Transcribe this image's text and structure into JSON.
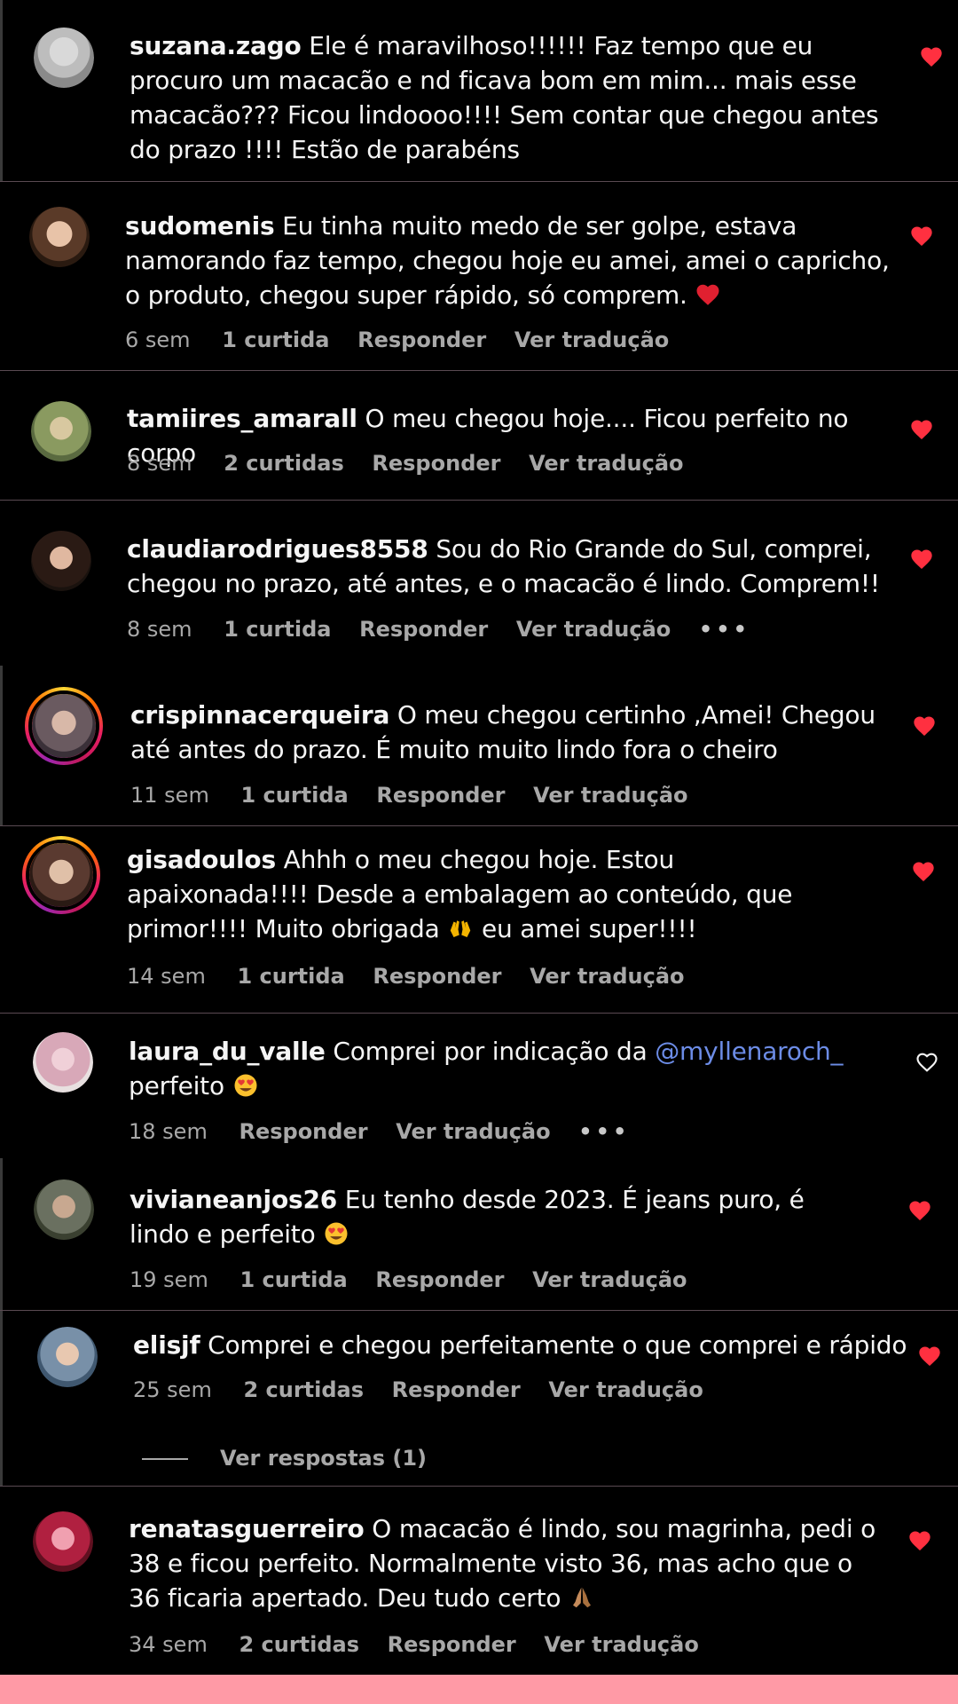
{
  "comments": [
    {
      "username": "suzana.zago",
      "text": "Ele é maravilhoso!!!!!! Faz tempo que eu procuro um macacão e nd ficava bom em mim... mais esse macacão??? Ficou lindoooo!!!! Sem contar que chegou antes do prazo !!!! Estão de parabéns",
      "liked": true
    },
    {
      "username": "sudomenis",
      "text": "Eu tinha muito medo de ser golpe, estava namorando faz tempo, chegou hoje eu amei, amei o capricho, o produto, chegou super rápido, só comprem.",
      "emoji": "heart-emoji",
      "time": "6 sem",
      "likes": "1 curtida",
      "reply": "Responder",
      "translate": "Ver tradução",
      "liked": true
    },
    {
      "username": "tamiires_amarall",
      "text": "O meu chegou hoje.... Ficou perfeito no corpo",
      "time": "8 sem",
      "likes": "2 curtidas",
      "reply": "Responder",
      "translate": "Ver tradução",
      "liked": true
    },
    {
      "username": "claudiarodrigues8558",
      "text": "Sou do Rio Grande do Sul, comprei, chegou no prazo, até antes, e o macacão é lindo. Comprem!!",
      "time": "8 sem",
      "likes": "1 curtida",
      "reply": "Responder",
      "translate": "Ver tradução",
      "more": "•••",
      "liked": true
    },
    {
      "username": "crispinnacerqueira",
      "text": "O meu chegou certinho ,Amei! Chegou até antes do prazo. É muito muito lindo fora o cheiro",
      "time": "11 sem",
      "likes": "1 curtida",
      "reply": "Responder",
      "translate": "Ver tradução",
      "liked": true,
      "story_ring": true
    },
    {
      "username": "gisadoulos",
      "text_a": "Ahhh o meu chegou hoje. Estou apaixonada!!!! Desde a embalagem ao conteúdo, que primor!!!! Muito obrigada",
      "emoji": "raised-hands-emoji",
      "text_b": "eu amei super!!!!",
      "time": "14 sem",
      "likes": "1 curtida",
      "reply": "Responder",
      "translate": "Ver tradução",
      "liked": true,
      "story_ring": true
    },
    {
      "username": "laura_du_valle",
      "text": "Comprei por indicação da",
      "mention": "@myllenaroch_",
      "text_b": "perfeito",
      "emoji": "heart-eyes-emoji",
      "time": "18 sem",
      "reply": "Responder",
      "translate": "Ver tradução",
      "more": "•••",
      "liked": false
    },
    {
      "username": "vivianeanjos26",
      "text": "Eu tenho desde 2023. É jeans puro, é lindo e perfeito",
      "emoji": "heart-eyes-emoji",
      "time": "19 sem",
      "likes": "1 curtida",
      "reply": "Responder",
      "translate": "Ver tradução",
      "liked": true
    },
    {
      "username": "elisjf",
      "text": "Comprei e chegou perfeitamente o que comprei e rápido",
      "time": "25 sem",
      "likes": "2 curtidas",
      "reply": "Responder",
      "translate": "Ver tradução",
      "view_replies": "Ver respostas (1)",
      "liked": true
    },
    {
      "username": "renatasguerreiro",
      "text": "O macacão é lindo, sou magrinha, pedi o 38 e ficou perfeito. Normalmente visto 36, mas acho que o 36 ficaria apertado. Deu tudo certo",
      "emoji": "praying-hands-emoji",
      "time": "34 sem",
      "likes": "2 curtidas",
      "reply": "Responder",
      "translate": "Ver tradução",
      "liked": true
    }
  ],
  "colors": {
    "background": "#000000",
    "heart_liked": "#ff3040",
    "mention": "#6c8ce6",
    "meta_text": "#a8a8a8",
    "bottom_bar": "#ff9aa6"
  }
}
